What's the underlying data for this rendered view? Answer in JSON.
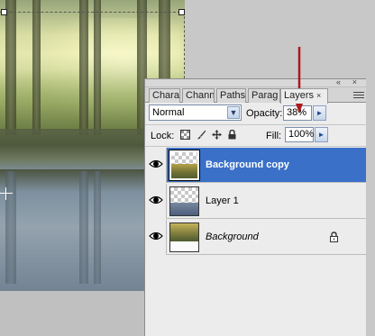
{
  "panel": {
    "tabs": [
      {
        "label": "Chara",
        "active": false
      },
      {
        "label": "Chann",
        "active": false
      },
      {
        "label": "Paths",
        "active": false
      },
      {
        "label": "Parag",
        "active": false
      },
      {
        "label": "Layers",
        "active": true
      }
    ],
    "tab_close_glyph": "×",
    "collapse_glyph": "«",
    "close_glyph": "×",
    "blend_mode": "Normal",
    "opacity_label": "Opacity:",
    "opacity_value": "38%",
    "lock_label": "Lock:",
    "fill_label": "Fill:",
    "fill_value": "100%",
    "layers": [
      {
        "name": "Background copy",
        "selected": true,
        "visible": true,
        "locked": false,
        "italic": false
      },
      {
        "name": "Layer 1",
        "selected": false,
        "visible": true,
        "locked": false,
        "italic": false
      },
      {
        "name": "Background",
        "selected": false,
        "visible": true,
        "locked": true,
        "italic": true
      }
    ]
  },
  "colors": {
    "selection_blue": "#3a70c8",
    "annotation_arrow": "#b01818",
    "panel_bg": "#ececec"
  },
  "icons": {
    "eye": "eye-icon",
    "lock_transparent": "lock-transparent-icon",
    "lock_paint": "brush-icon",
    "lock_move": "move-icon",
    "lock_all": "lock-icon",
    "dropdown": "chevron-down-icon",
    "spinner": "triangle-right-icon",
    "panel_menu": "panel-menu-icon"
  }
}
